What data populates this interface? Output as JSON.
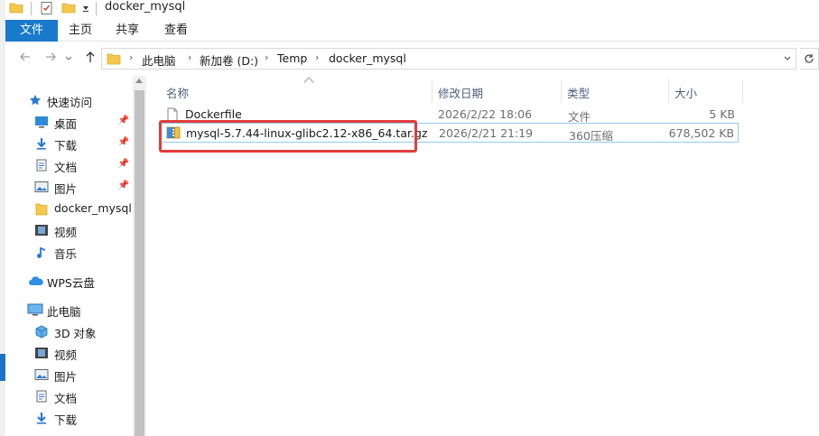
{
  "window": {
    "title": "docker_mysql"
  },
  "ribbon": {
    "tabs": [
      {
        "label": "文件"
      },
      {
        "label": "主页"
      },
      {
        "label": "共享"
      },
      {
        "label": "查看"
      }
    ]
  },
  "address": {
    "crumbs": [
      "此电脑",
      "新加卷 (D:)",
      "Temp",
      "docker_mysql"
    ],
    "separator": "›"
  },
  "sidebar": {
    "items": [
      {
        "label": "快速访问",
        "icon": "star-icon"
      },
      {
        "label": "桌面",
        "icon": "desktop-icon",
        "pinned": true
      },
      {
        "label": "下载",
        "icon": "download-icon",
        "pinned": true
      },
      {
        "label": "文档",
        "icon": "document-icon",
        "pinned": true
      },
      {
        "label": "图片",
        "icon": "pictures-icon",
        "pinned": true
      },
      {
        "label": "docker_mysql",
        "icon": "folder-icon"
      },
      {
        "label": "视频",
        "icon": "video-icon"
      },
      {
        "label": "音乐",
        "icon": "music-icon"
      },
      {
        "label": "WPS云盘",
        "icon": "cloud-icon"
      },
      {
        "label": "此电脑",
        "icon": "computer-icon"
      },
      {
        "label": "3D 对象",
        "icon": "3d-objects-icon"
      },
      {
        "label": "视频",
        "icon": "video-icon"
      },
      {
        "label": "图片",
        "icon": "pictures-icon"
      },
      {
        "label": "文档",
        "icon": "document-icon"
      },
      {
        "label": "下载",
        "icon": "download-icon"
      }
    ]
  },
  "columns": {
    "name": "名称",
    "date": "修改日期",
    "type": "类型",
    "size": "大小"
  },
  "files": [
    {
      "name": "Dockerfile",
      "date": "2026/2/22 18:06",
      "type": "文件",
      "size": "5 KB",
      "icon": "file-icon"
    },
    {
      "name": "mysql-5.7.44-linux-glibc2.12-x86_64.tar.gz",
      "date": "2026/2/21 21:19",
      "type": "360压缩",
      "size": "678,502 KB",
      "icon": "archive-icon"
    }
  ],
  "colors": {
    "accent": "#1979ca",
    "highlight_border": "#e23b3b",
    "folder": "#f5c84c"
  }
}
